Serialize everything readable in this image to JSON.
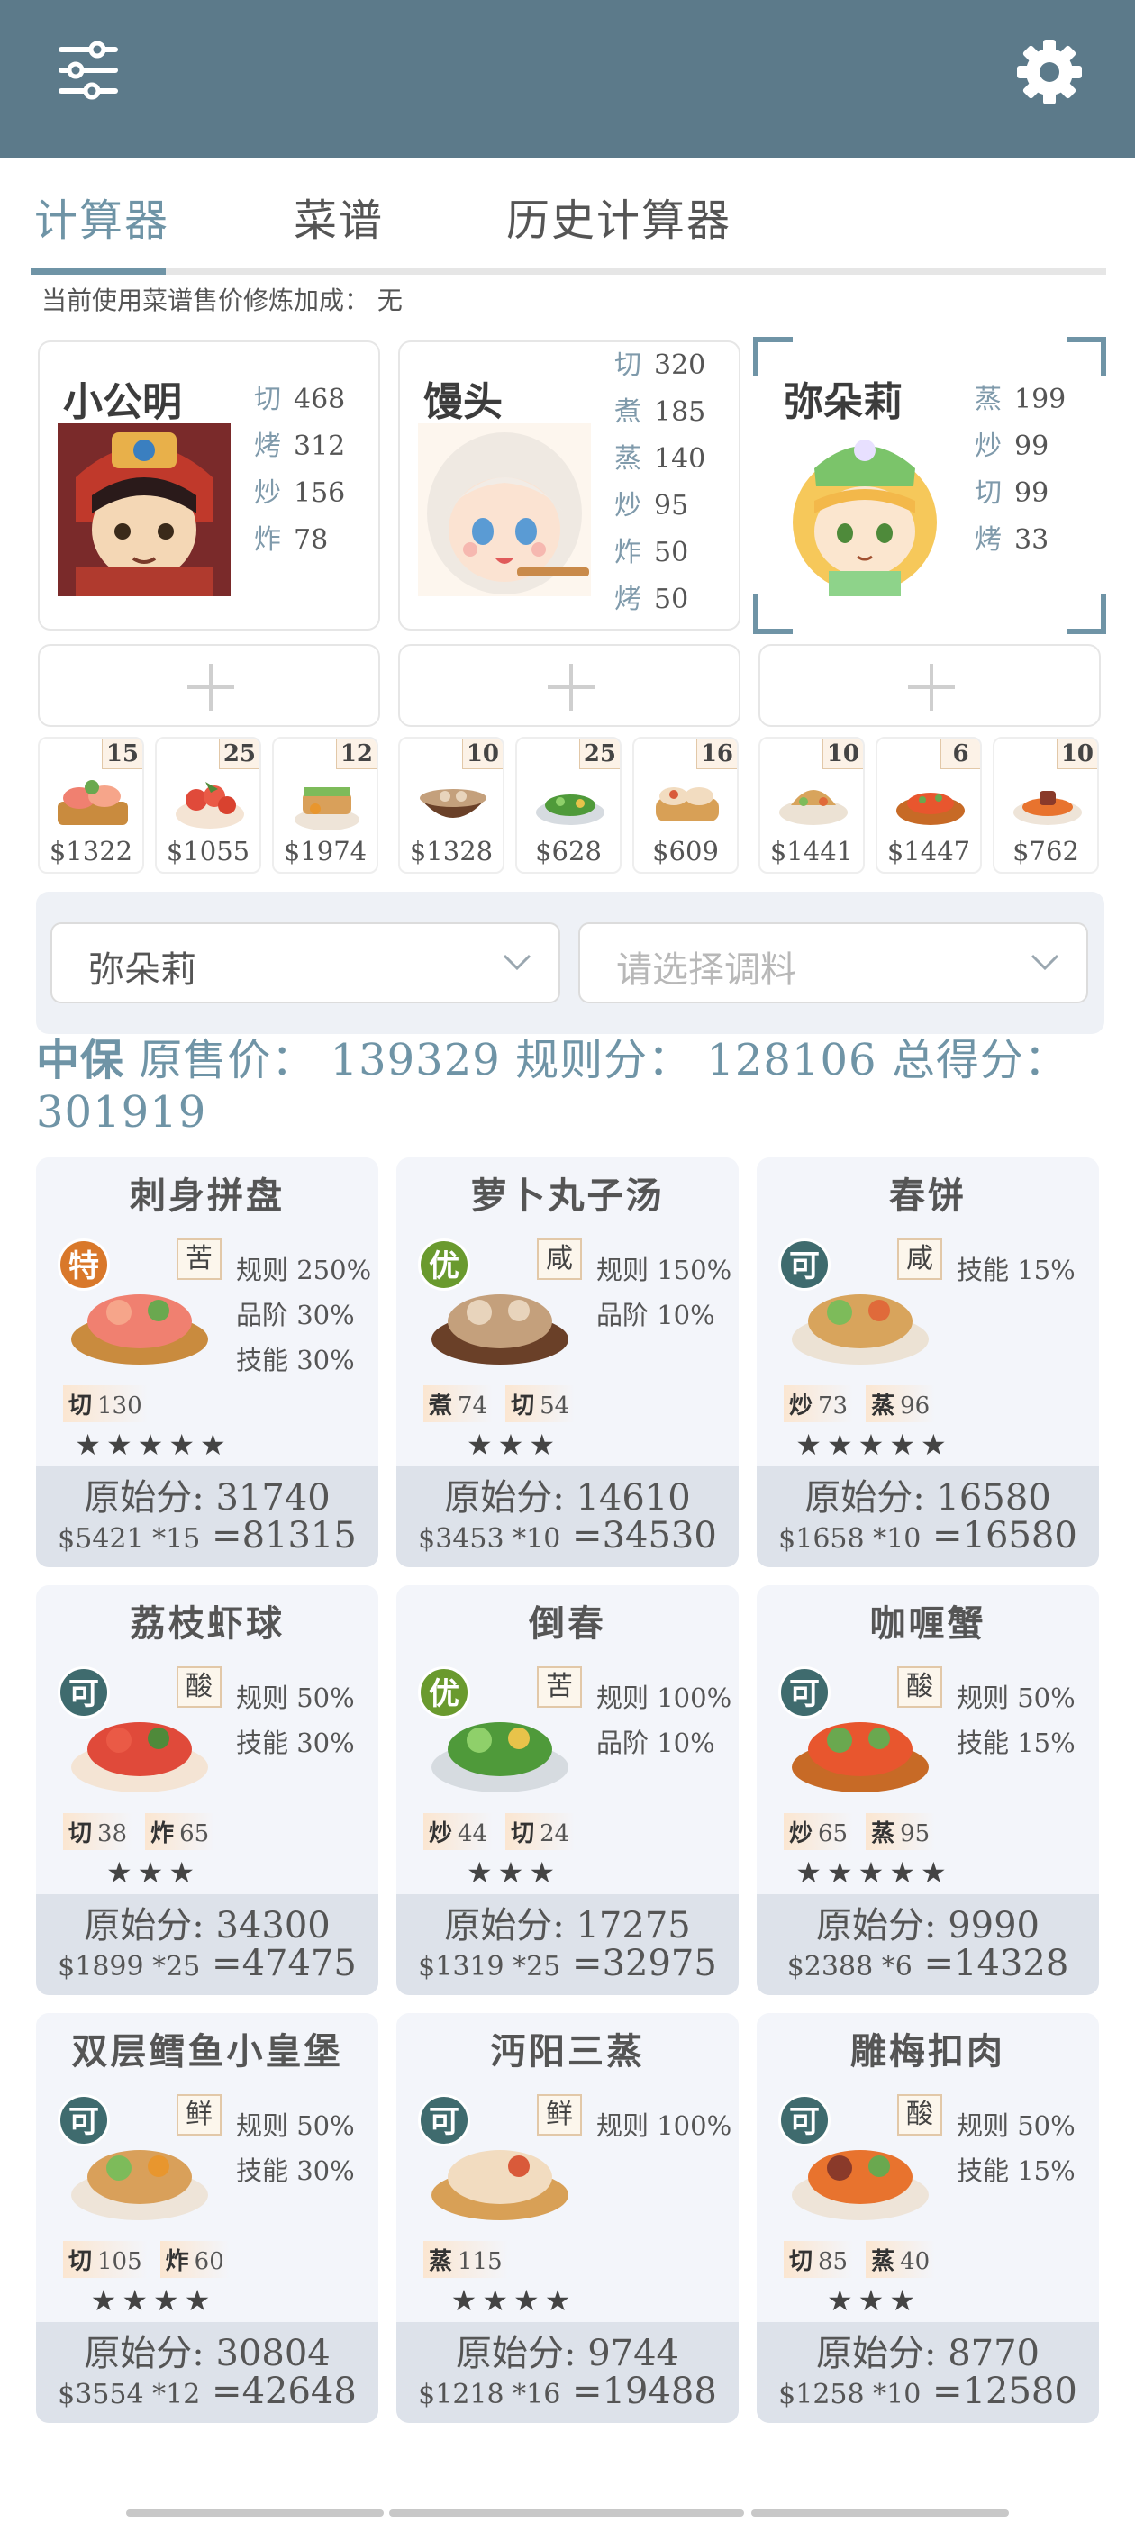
{
  "toolbar": {
    "menu_icon": "sliders-icon",
    "settings_icon": "gear-icon"
  },
  "tabs": [
    {
      "label": "计算器",
      "active": true
    },
    {
      "label": "菜谱",
      "active": false
    },
    {
      "label": "历史计算器",
      "active": false
    }
  ],
  "bonus_note": "当前使用菜谱售价修炼加成： 无",
  "chefs": [
    {
      "name": "小公明",
      "skills": [
        [
          "切",
          "468"
        ],
        [
          "烤",
          "312"
        ],
        [
          "炒",
          "156"
        ],
        [
          "炸",
          "78"
        ]
      ]
    },
    {
      "name": "馒头",
      "skills": [
        [
          "切",
          "320"
        ],
        [
          "煮",
          "185"
        ],
        [
          "蒸",
          "140"
        ],
        [
          "炒",
          "95"
        ],
        [
          "炸",
          "50"
        ],
        [
          "烤",
          "50"
        ]
      ]
    },
    {
      "name": "弥朵莉",
      "skills": [
        [
          "蒸",
          "199"
        ],
        [
          "炒",
          "99"
        ],
        [
          "切",
          "99"
        ],
        [
          "烤",
          "33"
        ]
      ],
      "selected": true
    }
  ],
  "thumbs": [
    {
      "qty": "15",
      "price": "$1322"
    },
    {
      "qty": "25",
      "price": "$1055"
    },
    {
      "qty": "12",
      "price": "$1974"
    },
    {
      "qty": "10",
      "price": "$1328"
    },
    {
      "qty": "25",
      "price": "$628"
    },
    {
      "qty": "16",
      "price": "$609"
    },
    {
      "qty": "10",
      "price": "$1441"
    },
    {
      "qty": "6",
      "price": "$1447"
    },
    {
      "qty": "10",
      "price": "$762"
    }
  ],
  "selector": {
    "chef_value": "弥朵莉",
    "seasoning_placeholder": "请选择调料"
  },
  "summary": {
    "rank": "中保",
    "sale_label": "原售价：",
    "sale_value": "139329",
    "rule_label": "规则分：",
    "rule_value": "128106",
    "total_label": "总得分：",
    "total_value": "301919"
  },
  "dishes": [
    {
      "title": "刺身拼盘",
      "grade": "特",
      "grade_color": "#d9782a",
      "flavor": "苦",
      "bonuses": [
        "规则 250%",
        "品阶 30%",
        "技能 30%"
      ],
      "reqs": [
        [
          "切",
          "130"
        ]
      ],
      "stars": "★★★★★",
      "base": "原始分: 31740",
      "calc_left": "$5421 *15",
      "calc_total": "=81315"
    },
    {
      "title": "萝卜丸子汤",
      "grade": "优",
      "grade_color": "#6a9a2e",
      "flavor": "咸",
      "bonuses": [
        "规则 150%",
        "品阶 10%"
      ],
      "reqs": [
        [
          "煮",
          "74"
        ],
        [
          "切",
          "54"
        ]
      ],
      "stars": "★★★",
      "base": "原始分: 14610",
      "calc_left": "$3453 *10",
      "calc_total": "=34530"
    },
    {
      "title": "春饼",
      "grade": "可",
      "grade_color": "#3f6b6e",
      "flavor": "咸",
      "bonuses": [
        "技能 15%"
      ],
      "reqs": [
        [
          "炒",
          "73"
        ],
        [
          "蒸",
          "96"
        ]
      ],
      "stars": "★★★★★",
      "base": "原始分: 16580",
      "calc_left": "$1658 *10",
      "calc_total": "=16580"
    },
    {
      "title": "荔枝虾球",
      "grade": "可",
      "grade_color": "#3f6b6e",
      "flavor": "酸",
      "bonuses": [
        "规则 50%",
        "技能 30%"
      ],
      "reqs": [
        [
          "切",
          "38"
        ],
        [
          "炸",
          "65"
        ]
      ],
      "stars": "★★★",
      "base": "原始分: 34300",
      "calc_left": "$1899 *25",
      "calc_total": "=47475"
    },
    {
      "title": "倒春",
      "grade": "优",
      "grade_color": "#6a9a2e",
      "flavor": "苦",
      "bonuses": [
        "规则 100%",
        "品阶 10%"
      ],
      "reqs": [
        [
          "炒",
          "44"
        ],
        [
          "切",
          "24"
        ]
      ],
      "stars": "★★★",
      "base": "原始分: 17275",
      "calc_left": "$1319 *25",
      "calc_total": "=32975"
    },
    {
      "title": "咖喱蟹",
      "grade": "可",
      "grade_color": "#3f6b6e",
      "flavor": "酸",
      "bonuses": [
        "规则 50%",
        "技能 15%"
      ],
      "reqs": [
        [
          "炒",
          "65"
        ],
        [
          "蒸",
          "95"
        ]
      ],
      "stars": "★★★★★",
      "base": "原始分: 9990",
      "calc_left": "$2388 *6",
      "calc_total": "=14328"
    },
    {
      "title": "双层鳕鱼小皇堡",
      "grade": "可",
      "grade_color": "#3f6b6e",
      "flavor": "鲜",
      "bonuses": [
        "规则 50%",
        "技能 30%"
      ],
      "reqs": [
        [
          "切",
          "105"
        ],
        [
          "炸",
          "60"
        ]
      ],
      "stars": "★★★★",
      "base": "原始分: 30804",
      "calc_left": "$3554 *12",
      "calc_total": "=42648"
    },
    {
      "title": "沔阳三蒸",
      "grade": "可",
      "grade_color": "#3f6b6e",
      "flavor": "鲜",
      "bonuses": [
        "规则 100%"
      ],
      "reqs": [
        [
          "蒸",
          "115"
        ]
      ],
      "stars": "★★★★",
      "base": "原始分: 9744",
      "calc_left": "$1218 *16",
      "calc_total": "=19488"
    },
    {
      "title": "雕梅扣肉",
      "grade": "可",
      "grade_color": "#3f6b6e",
      "flavor": "酸",
      "bonuses": [
        "规则 50%",
        "技能 15%"
      ],
      "reqs": [
        [
          "切",
          "85"
        ],
        [
          "蒸",
          "40"
        ]
      ],
      "stars": "★★★",
      "base": "原始分: 8770",
      "calc_left": "$1258 *10",
      "calc_total": "=12580"
    }
  ]
}
